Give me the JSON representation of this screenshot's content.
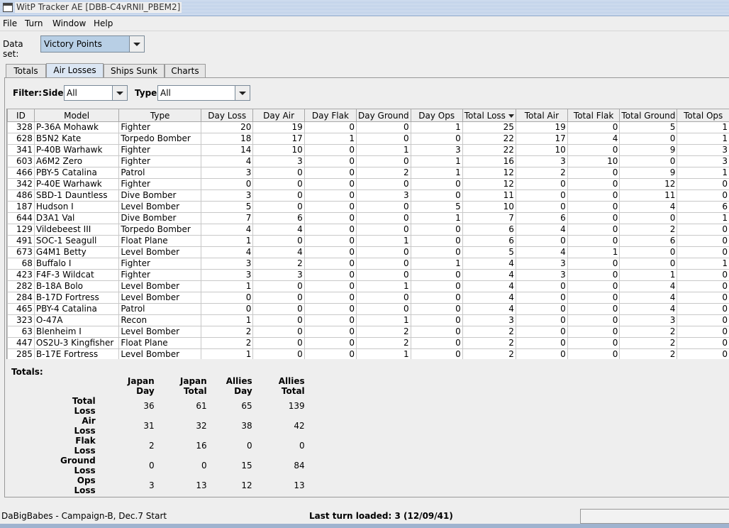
{
  "window": {
    "title": "WitP Tracker AE [DBB-C4vRNII_PBEM2]"
  },
  "menu": [
    "File",
    "Turn",
    "Window",
    "Help"
  ],
  "dataset": {
    "label": "Data set:",
    "value": "Victory Points"
  },
  "tabs": [
    "Totals",
    "Air Losses",
    "Ships Sunk",
    "Charts"
  ],
  "active_tab": "Air Losses",
  "filter": {
    "label": "Filter:",
    "side_label": "Side:",
    "side_value": "All",
    "type_label": "Type:",
    "type_value": "All"
  },
  "table": {
    "columns": [
      "ID",
      "Model",
      "Type",
      "Day Loss",
      "Day Air",
      "Day Flak",
      "Day Ground",
      "Day Ops",
      "Total Loss",
      "Total Air",
      "Total Flak",
      "Total Ground",
      "Total Ops"
    ],
    "sorted_column": "Total Loss",
    "rows": [
      [
        "328",
        "P-36A Mohawk",
        "Fighter",
        "20",
        "19",
        "0",
        "0",
        "1",
        "25",
        "19",
        "0",
        "5",
        "1"
      ],
      [
        "628",
        "B5N2 Kate",
        "Torpedo Bomber",
        "18",
        "17",
        "1",
        "0",
        "0",
        "22",
        "17",
        "4",
        "0",
        "1"
      ],
      [
        "341",
        "P-40B Warhawk",
        "Fighter",
        "14",
        "10",
        "0",
        "1",
        "3",
        "22",
        "10",
        "0",
        "9",
        "3"
      ],
      [
        "603",
        "A6M2 Zero",
        "Fighter",
        "4",
        "3",
        "0",
        "0",
        "1",
        "16",
        "3",
        "10",
        "0",
        "3"
      ],
      [
        "466",
        "PBY-5 Catalina",
        "Patrol",
        "3",
        "0",
        "0",
        "2",
        "1",
        "12",
        "2",
        "0",
        "9",
        "1"
      ],
      [
        "342",
        "P-40E Warhawk",
        "Fighter",
        "0",
        "0",
        "0",
        "0",
        "0",
        "12",
        "0",
        "0",
        "12",
        "0"
      ],
      [
        "486",
        "SBD-1 Dauntless",
        "Dive Bomber",
        "3",
        "0",
        "0",
        "3",
        "0",
        "11",
        "0",
        "0",
        "11",
        "0"
      ],
      [
        "187",
        "Hudson I",
        "Level Bomber",
        "5",
        "0",
        "0",
        "0",
        "5",
        "10",
        "0",
        "0",
        "4",
        "6"
      ],
      [
        "644",
        "D3A1 Val",
        "Dive Bomber",
        "7",
        "6",
        "0",
        "0",
        "1",
        "7",
        "6",
        "0",
        "0",
        "1"
      ],
      [
        "129",
        "Vildebeest III",
        "Torpedo Bomber",
        "4",
        "4",
        "0",
        "0",
        "0",
        "6",
        "4",
        "0",
        "2",
        "0"
      ],
      [
        "491",
        "SOC-1 Seagull",
        "Float Plane",
        "1",
        "0",
        "0",
        "1",
        "0",
        "6",
        "0",
        "0",
        "6",
        "0"
      ],
      [
        "673",
        "G4M1 Betty",
        "Level Bomber",
        "4",
        "4",
        "0",
        "0",
        "0",
        "5",
        "4",
        "1",
        "0",
        "0"
      ],
      [
        "68",
        "Buffalo I",
        "Fighter",
        "3",
        "2",
        "0",
        "0",
        "1",
        "4",
        "3",
        "0",
        "0",
        "1"
      ],
      [
        "423",
        "F4F-3 Wildcat",
        "Fighter",
        "3",
        "3",
        "0",
        "0",
        "0",
        "4",
        "3",
        "0",
        "1",
        "0"
      ],
      [
        "282",
        "B-18A Bolo",
        "Level Bomber",
        "1",
        "0",
        "0",
        "1",
        "0",
        "4",
        "0",
        "0",
        "4",
        "0"
      ],
      [
        "284",
        "B-17D Fortress",
        "Level Bomber",
        "0",
        "0",
        "0",
        "0",
        "0",
        "4",
        "0",
        "0",
        "4",
        "0"
      ],
      [
        "465",
        "PBY-4 Catalina",
        "Patrol",
        "0",
        "0",
        "0",
        "0",
        "0",
        "4",
        "0",
        "0",
        "4",
        "0"
      ],
      [
        "323",
        "O-47A",
        "Recon",
        "1",
        "0",
        "0",
        "1",
        "0",
        "3",
        "0",
        "0",
        "3",
        "0"
      ],
      [
        "63",
        "Blenheim I",
        "Level Bomber",
        "2",
        "0",
        "0",
        "2",
        "0",
        "2",
        "0",
        "0",
        "2",
        "0"
      ],
      [
        "447",
        "OS2U-3 Kingfisher",
        "Float Plane",
        "2",
        "0",
        "0",
        "2",
        "0",
        "2",
        "0",
        "0",
        "2",
        "0"
      ],
      [
        "285",
        "B-17E Fortress",
        "Level Bomber",
        "1",
        "0",
        "0",
        "1",
        "0",
        "2",
        "0",
        "0",
        "2",
        "0"
      ]
    ]
  },
  "totals": {
    "label": "Totals:",
    "columns": [
      "Japan Day",
      "Japan Total",
      "Allies Day",
      "Allies Total"
    ],
    "rows": [
      {
        "label": "Total Loss",
        "values": [
          "36",
          "61",
          "65",
          "139"
        ]
      },
      {
        "label": "Air Loss",
        "values": [
          "31",
          "32",
          "38",
          "42"
        ]
      },
      {
        "label": "Flak Loss",
        "values": [
          "2",
          "16",
          "0",
          "0"
        ]
      },
      {
        "label": "Ground Loss",
        "values": [
          "0",
          "0",
          "15",
          "84"
        ]
      },
      {
        "label": "Ops Loss",
        "values": [
          "3",
          "13",
          "12",
          "13"
        ]
      }
    ]
  },
  "status": {
    "left": "DaBigBabes - Campaign-B, Dec.7 Start",
    "middle": "Last turn loaded: 3 (12/09/41)"
  }
}
